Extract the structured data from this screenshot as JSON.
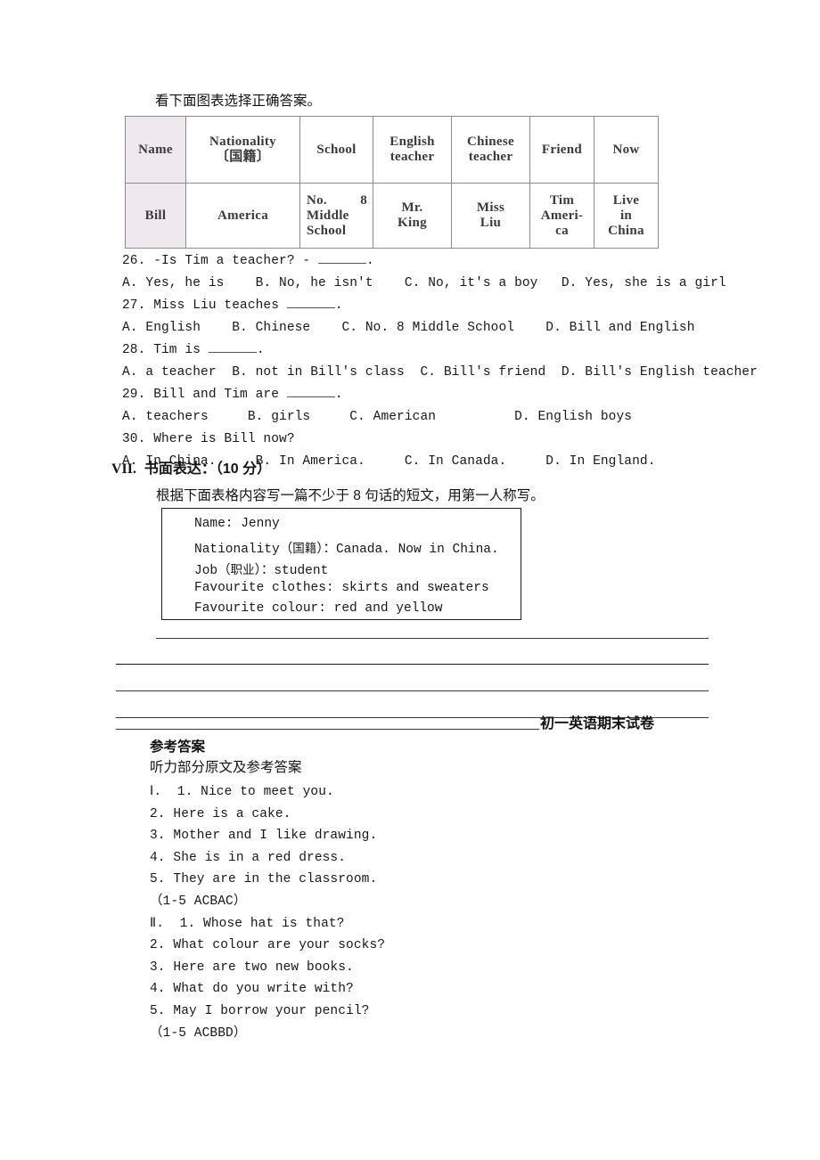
{
  "intro": {
    "instruction": "看下面图表选择正确答案。"
  },
  "info_table": {
    "headers": [
      "Name",
      "Nationality〔国籍〕",
      "School",
      "English teacher",
      "Chinese teacher",
      "Friend",
      "Now"
    ],
    "header_cells": {
      "name": "Name",
      "nationality_line1": "Nationality",
      "nationality_line2": "〔国籍〕",
      "school": "School",
      "english_line1": "English",
      "english_line2": "teacher",
      "chinese_line1": "Chinese",
      "chinese_line2": "teacher",
      "friend": "Friend",
      "now": "Now"
    },
    "row": {
      "name": "Bill",
      "nationality": "America",
      "school_line1": "No. 8",
      "school_line2": "Middle",
      "school_line3": "School",
      "english_line1": "Mr.",
      "english_line2": "King",
      "chinese_line1": "Miss",
      "chinese_line2": "Liu",
      "friend_line1": "Tim",
      "friend_line2": "Ameri-",
      "friend_line3": "ca",
      "now_line1": "Live",
      "now_line2": "in",
      "now_line3": "China"
    },
    "shade_color": "#efe8ec",
    "border_color": "#8d8a93"
  },
  "questions": [
    {
      "stem_pre": "26. -Is Tim a teacher? - ",
      "stem_post": ".",
      "has_blank": true,
      "options": "A. Yes, he is    B. No, he isn't    C. No, it's a boy   D. Yes, she is a girl"
    },
    {
      "stem_pre": "27. Miss Liu teaches ",
      "stem_post": ".",
      "has_blank": true,
      "options": "A. English    B. Chinese    C. No. 8 Middle School    D. Bill and English"
    },
    {
      "stem_pre": "28. Tim is ",
      "stem_post": ".",
      "has_blank": true,
      "options": "A. a teacher  B. not in Bill's class  C. Bill's friend  D. Bill's English teacher"
    },
    {
      "stem_pre": "29. Bill and Tim are ",
      "stem_post": ".",
      "has_blank": true,
      "options": "A. teachers     B. girls     C. American          D. English boys"
    },
    {
      "stem_pre": "30. Where is Bill now?",
      "stem_post": "",
      "has_blank": false,
      "options": "A. In China.     B. In America.     C. In Canada.     D. In England."
    }
  ],
  "section_vii": {
    "numeral": "VII.",
    "title": "书面表达：（10 分）",
    "prompt": "根据下面表格内容写一篇不少于 8 句话的短文，用第一人称写。"
  },
  "jenny_box": {
    "rows": [
      {
        "pre": "Name: Jenny",
        "cjk": "",
        "post": ""
      },
      {
        "pre": "Nationality（",
        "cjk": "国籍",
        "post": "）：Canada. Now in China."
      },
      {
        "pre": "Job（",
        "cjk": "职业",
        "post": "）：student"
      },
      {
        "pre": "Favourite clothes: skirts and sweaters",
        "cjk": "",
        "post": ""
      },
      {
        "pre": "Favourite colour: red and yellow",
        "cjk": "",
        "post": ""
      }
    ]
  },
  "footer": {
    "title": "初一英语期末试卷"
  },
  "answer_key": {
    "heading": "参考答案",
    "subheading": "听力部分原文及参考答案",
    "lines": [
      "Ⅰ.  1. Nice to meet you.",
      "2. Here is a cake.",
      "3. Mother and I like drawing.",
      "4. She is in a red dress.",
      "5. They are in the classroom.",
      "（1-5 ACBAC）",
      "Ⅱ.  1. Whose hat is that?",
      "2. What colour are your socks?",
      "3. Here are two new books.",
      "4. What do you write with?",
      "5. May I borrow your pencil?",
      "（1-5 ACBBD）"
    ]
  }
}
